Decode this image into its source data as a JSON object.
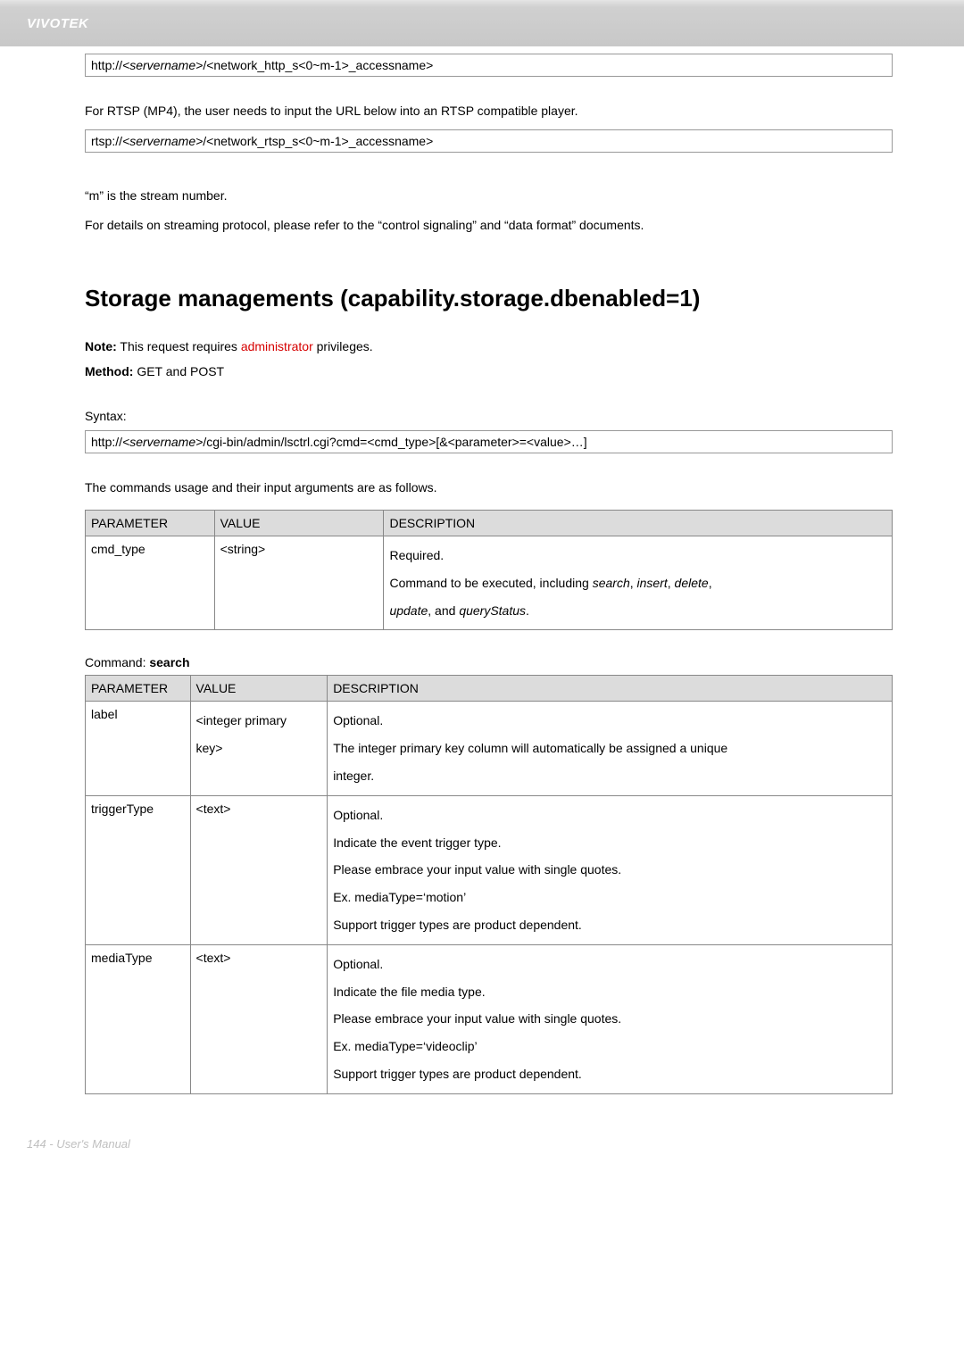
{
  "header": {
    "brand": "VIVOTEK"
  },
  "url_boxes": {
    "http_access": {
      "prefix": "http://",
      "servername": "<servername>",
      "rest": "/<network_http_s<0~m-1>_accessname>"
    },
    "rtsp_access": {
      "prefix": "rtsp://",
      "servername": "<servername>",
      "rest": "/<network_rtsp_s<0~m-1>_accessname>"
    },
    "lsctrl": {
      "prefix": "http://",
      "servername": "<servername>",
      "rest": "/cgi-bin/admin/lsctrl.cgi?cmd=<cmd_type>[&<parameter>=<value>…]"
    }
  },
  "paragraphs": {
    "rtsp_intro": "For RTSP (MP4), the user needs to input the URL below into an RTSP compatible player.",
    "m_note": "“m” is the stream number.",
    "details": "For details on streaming protocol, please refer to the “control signaling” and “data format” documents.",
    "usage": "The commands usage and their input arguments are as follows."
  },
  "heading": "Storage managements (capability.storage.dbenabled=1)",
  "note": {
    "label": "Note:",
    "before": " This request requires ",
    "priv": "administrator",
    "after": " privileges."
  },
  "method": {
    "label": "Method:",
    "value": " GET and POST"
  },
  "syntax_label": "Syntax:",
  "table1": {
    "headers": {
      "p": "PARAMETER",
      "v": "VALUE",
      "d": "DESCRIPTION"
    },
    "row": {
      "param": "cmd_type",
      "value": "<string>",
      "desc_l1": "Required.",
      "desc_l2a": "Command to be executed, including ",
      "desc_l2_i1": "search",
      "desc_l2_s1": ", ",
      "desc_l2_i2": "insert",
      "desc_l2_s2": ", ",
      "desc_l2_i3": "delete",
      "desc_l2_s3": ", ",
      "desc_l3_i1": "update",
      "desc_l3_s1": ", and ",
      "desc_l3_i2": "queryStatus",
      "desc_l3_s2": "."
    }
  },
  "command_label": {
    "prefix": "Command: ",
    "name": "search"
  },
  "table2": {
    "headers": {
      "p": "PARAMETER",
      "v": "VALUE",
      "d": "DESCRIPTION"
    },
    "rows": [
      {
        "param": "label",
        "value_l1": "<integer primary",
        "value_l2": "key>",
        "d1": "Optional.",
        "d2": "The integer primary key column will automatically be assigned a unique",
        "d3": "integer."
      },
      {
        "param": "triggerType",
        "value": "<text>",
        "d1": "Optional.",
        "d2": "Indicate the event trigger type.",
        "d3": "Please embrace your input value with single quotes.",
        "d4": "Ex. mediaType=‘motion’",
        "d5": "Support trigger types are product dependent."
      },
      {
        "param": "mediaType",
        "value": "<text>",
        "d1": "Optional.",
        "d2": "Indicate the file media type.",
        "d3": "Please embrace your input value with single quotes.",
        "d4": "Ex. mediaType=‘videoclip’",
        "d5": "Support trigger types are product dependent."
      }
    ]
  },
  "footer": "144 - User's Manual"
}
